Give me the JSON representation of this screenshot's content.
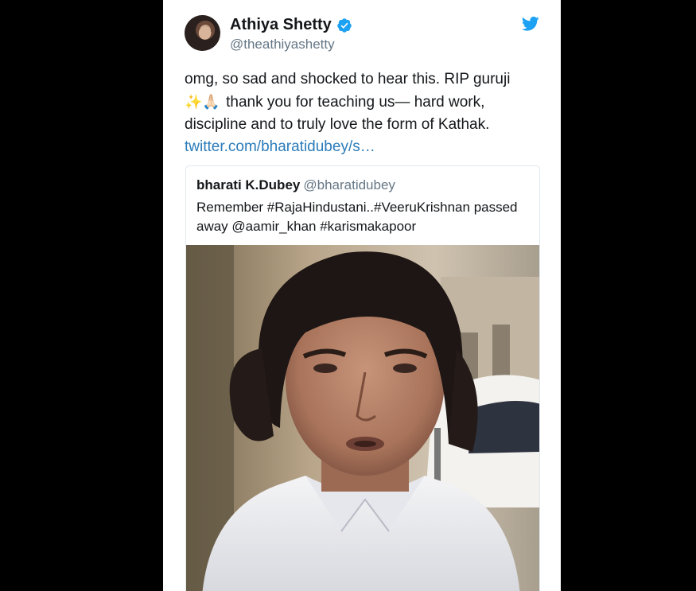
{
  "tweet": {
    "display_name": "Athiya Shetty",
    "handle": "@theathiyashetty",
    "text_line1": "omg, so sad and shocked to hear this. RIP guruji",
    "emoji": "✨🙏🏻",
    "text_line2": " thank you for teaching us— hard work,",
    "text_line3": "discipline and to truly love the form of Kathak.",
    "link": "twitter.com/bharatidubey/s…"
  },
  "quoted": {
    "display_name": "bharati K.Dubey",
    "handle": "@bharatidubey",
    "text_line1": "Remember #RajaHindustani..#VeeruKrishnan passed",
    "text_line2": "away @aamir_khan #karismakapoor"
  },
  "icons": {
    "verified": "verified-badge-icon",
    "brand": "twitter-bird-icon"
  },
  "colors": {
    "link": "#2b7bb9",
    "verified": "#1da1f2",
    "brand": "#1da1f2"
  }
}
